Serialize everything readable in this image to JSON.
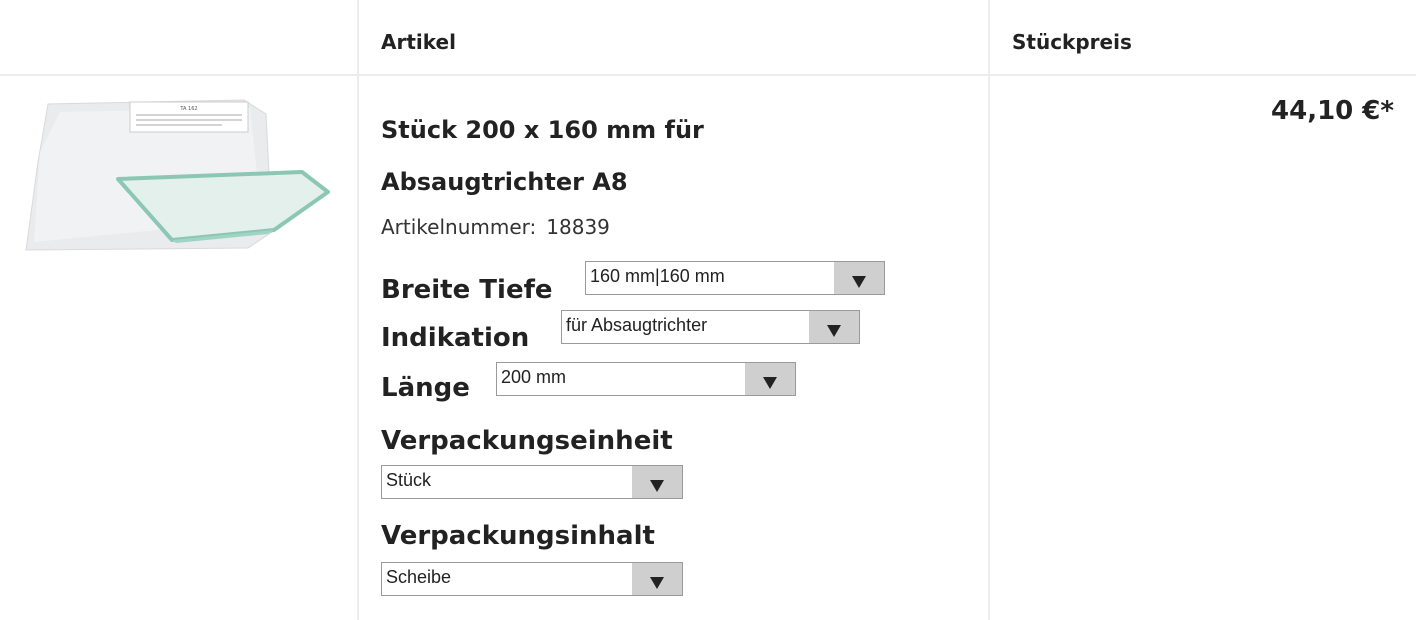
{
  "table": {
    "headers": {
      "image": "",
      "article": "Artikel",
      "unit_price": "Stückpreis"
    }
  },
  "product": {
    "title": "Stück 200 x 160 mm für Absaugtrichter A8",
    "article_number_label": "Artikelnummer:",
    "article_number": "18839",
    "price": "44,10 €*",
    "image_label_text": "TA 162"
  },
  "options": {
    "breite_tiefe": {
      "label": "Breite Tiefe",
      "value": "160 mm|160 mm"
    },
    "indikation": {
      "label": "Indikation",
      "value": "für Absaugtrichter"
    },
    "laenge": {
      "label": "Länge",
      "value": "200 mm"
    },
    "verpackungseinheit": {
      "label": "Verpackungseinheit",
      "value": "Stück"
    },
    "verpackungsinhalt": {
      "label": "Verpackungsinhalt",
      "value": "Scheibe"
    }
  }
}
